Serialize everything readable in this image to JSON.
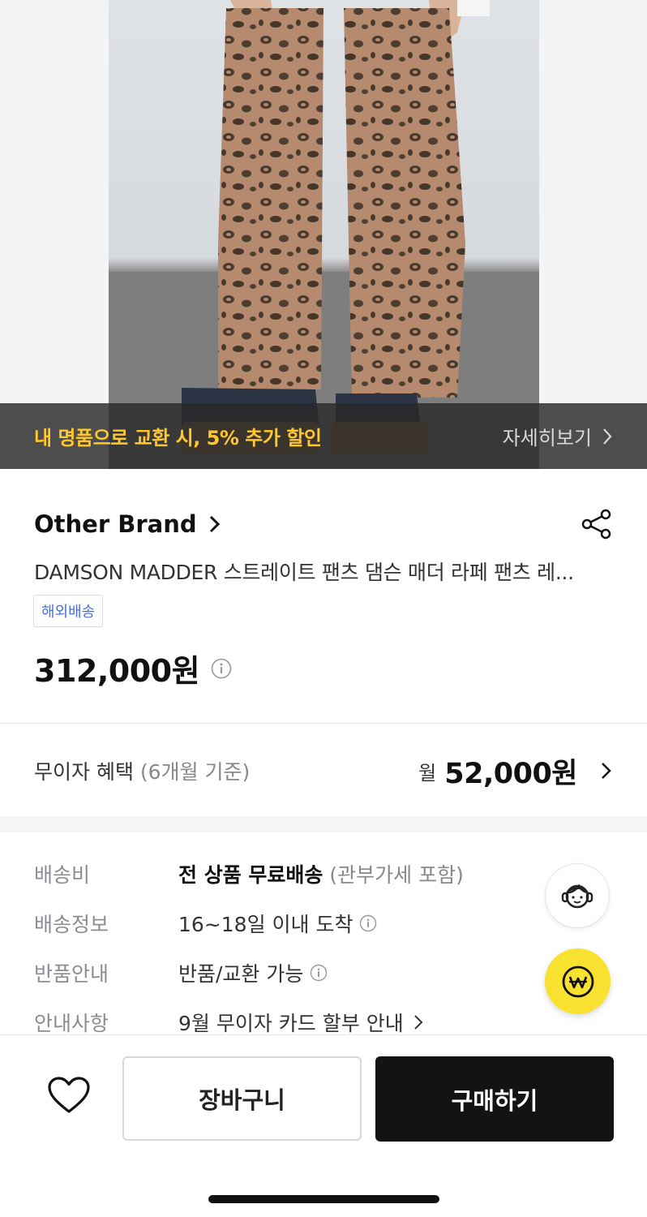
{
  "hero": {
    "promo_text": "내 명품으로 교환 시, 5% 추가 할인",
    "promo_more": "자세히보기"
  },
  "product": {
    "brand": "Other Brand",
    "title": "DAMSON MADDER 스트레이트 팬츠 댐슨 매더 라페 팬츠 레...",
    "tag": "해외배송",
    "price": "312,000원"
  },
  "installment": {
    "label": "무이자 혜택",
    "sub": "(6개월 기준)",
    "month_prefix": "월",
    "amount": "52,000원"
  },
  "shipping": [
    {
      "key": "배송비",
      "value_bold": "전 상품 무료배송",
      "value_muted": "(관부가세 포함)"
    },
    {
      "key": "배송정보",
      "value": "16~18일 이내 도착"
    },
    {
      "key": "반품안내",
      "value": "반품/교환 가능"
    },
    {
      "key": "안내사항",
      "value": "9월 무이자 카드 할부 안내"
    }
  ],
  "bottom_bar": {
    "cart_label": "장바구니",
    "buy_label": "구매하기"
  },
  "colors": {
    "promo_accent": "#ffc72c",
    "tag_blue": "#4a6fd8",
    "fab_yellow": "#f8e12f",
    "buy_button": "#121315"
  },
  "icons": [
    "share-icon",
    "info-icon",
    "chevron-right-icon",
    "headset-support-icon",
    "won-icon",
    "heart-icon"
  ]
}
